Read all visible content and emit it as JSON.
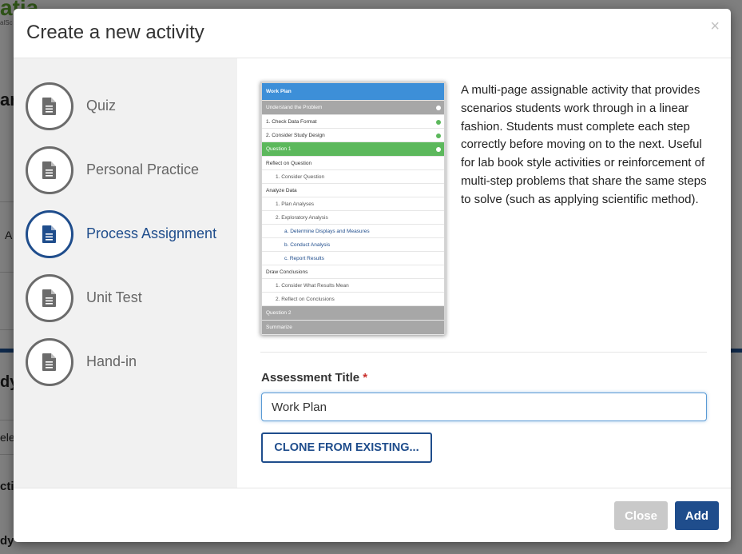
{
  "background": {
    "logo_text": "atia",
    "logo_sub": "alSc",
    "fragments": [
      "ar",
      "A",
      "dy",
      "ele",
      "ctic",
      "dy"
    ]
  },
  "modal": {
    "title": "Create a new activity",
    "close_glyph": "×"
  },
  "activity_types": [
    {
      "label": "Quiz",
      "icon": "document-icon",
      "active": false
    },
    {
      "label": "Personal Practice",
      "icon": "document-icon",
      "active": false
    },
    {
      "label": "Process Assignment",
      "icon": "document-icon",
      "active": true
    },
    {
      "label": "Unit Test",
      "icon": "document-icon",
      "active": false
    },
    {
      "label": "Hand-in",
      "icon": "document-icon",
      "active": false
    }
  ],
  "preview": {
    "rows": [
      {
        "text": "Work Plan",
        "style": "header"
      },
      {
        "text": "Understand the Problem",
        "style": "section",
        "check": true
      },
      {
        "text": "1. Check Data Format",
        "style": "item",
        "check": true
      },
      {
        "text": "2. Consider Study Design",
        "style": "item",
        "check": true
      },
      {
        "text": "Question 1",
        "style": "active-section",
        "check": true
      },
      {
        "text": "Reflect on Question",
        "style": "item"
      },
      {
        "text": "1. Consider Question",
        "style": "subitem"
      },
      {
        "text": "Analyze Data",
        "style": "item"
      },
      {
        "text": "1. Plan Analyses",
        "style": "subitem"
      },
      {
        "text": "2. Exploratory Analysis",
        "style": "subitem"
      },
      {
        "text": "a. Determine Displays and Measures",
        "style": "link"
      },
      {
        "text": "b. Conduct Analysis",
        "style": "link"
      },
      {
        "text": "c. Report Results",
        "style": "link"
      },
      {
        "text": "Draw Conclusions",
        "style": "item"
      },
      {
        "text": "1. Consider What Results Mean",
        "style": "subitem"
      },
      {
        "text": "2. Reflect on Conclusions",
        "style": "subitem"
      },
      {
        "text": "Question 2",
        "style": "section"
      },
      {
        "text": "Summarize",
        "style": "section"
      }
    ]
  },
  "description": "A multi-page assignable activity that provides scenarios students work through in a linear fashion. Students must complete each step correctly before moving on to the next. Useful for lab book style activities or reinforcement of multi-step problems that share the same steps to solve (such as applying scientific method).",
  "form": {
    "title_label": "Assessment Title",
    "required_marker": "*",
    "title_value": "Work Plan",
    "clone_label": "CLONE FROM EXISTING..."
  },
  "footer": {
    "close_label": "Close",
    "add_label": "Add"
  },
  "colors": {
    "primary": "#1f4d8c",
    "preview_header": "#3d8fd8",
    "preview_active": "#5cb85c",
    "preview_section": "#a7a7a7"
  }
}
